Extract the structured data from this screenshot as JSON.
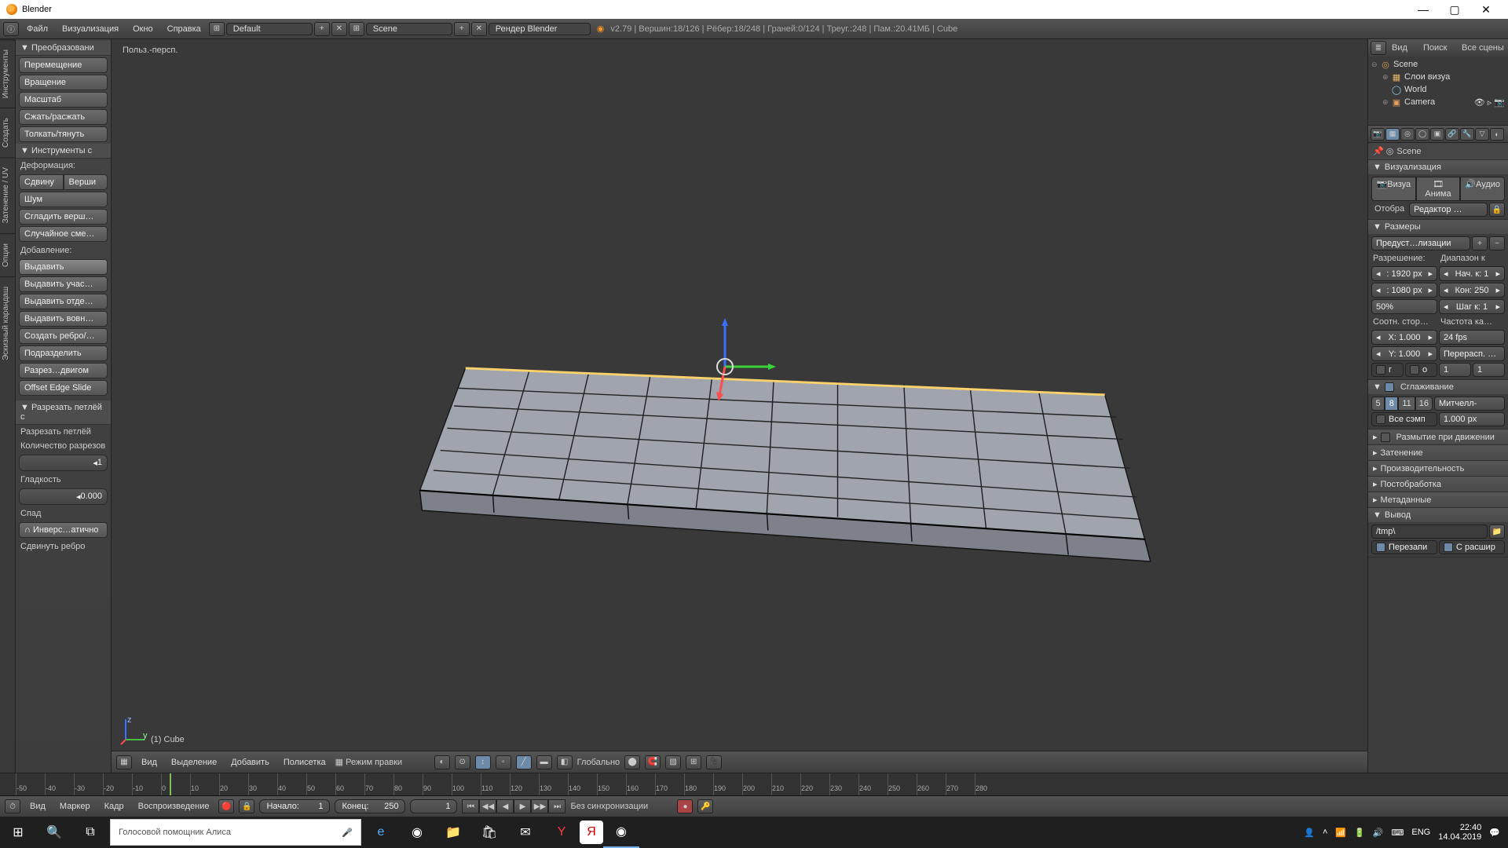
{
  "titlebar": {
    "title": "Blender"
  },
  "topmenu": {
    "file": "Файл",
    "render": "Визуализация",
    "window": "Окно",
    "help": "Справка"
  },
  "header": {
    "layout": "Default",
    "scene": "Scene",
    "engine": "Рендер Blender",
    "stats": "v2.79 | Вершин:18/126 | Рёбер:18/248 | Граней:0/124 | Треуг.:248 | Пам.:20.41МБ | Cube"
  },
  "viewport": {
    "persp": "Польз.-персп.",
    "objlabel": "(1) Cube"
  },
  "toolshelf": {
    "tabs": [
      "Инструменты",
      "Создать",
      "Затенение / UV",
      "Опции",
      "Эскизный карандаш"
    ],
    "transform_hdr": "Преобразовани",
    "transform": [
      "Перемещение",
      "Вращение",
      "Масштаб",
      "Сжать/расжать",
      "Толкать/тянуть"
    ],
    "meshtools_hdr": "Инструменты с",
    "deform_lbl": "Деформация:",
    "deform_row": [
      "Сдвину",
      "Верши"
    ],
    "deform_btns": [
      "Шум",
      "Сгладить верш…",
      "Случайное сме…"
    ],
    "add_lbl": "Добавление:",
    "add_btns": [
      "Выдавить",
      "Выдавить учас…",
      "Выдавить отде…",
      "Выдавить вовн…",
      "Создать ребро/…",
      "Подразделить",
      "Разрез…двигом",
      "Offset Edge Slide"
    ],
    "op_hdr": "Разрезать петлёй с",
    "op_line1": "Разрезать петлёй",
    "cuts_lbl": "Количество разрезов",
    "cuts_val": "1",
    "smooth_lbl": "Гладкость",
    "smooth_val": "0.000",
    "falloff_lbl": "Спад",
    "falloff_val": "Инверс…атично",
    "edgeslide": "Сдвинуть ребро"
  },
  "vpfooter": {
    "view": "Вид",
    "select": "Выделение",
    "add": "Добавить",
    "mesh": "Полисетка",
    "mode": "Режим правки",
    "orient": "Глобально"
  },
  "outliner": {
    "filter": "Поиск",
    "allscenes": "Все сцены",
    "scene": "Scene",
    "renderlayers": "Слои визуа",
    "world": "World",
    "camera": "Camera",
    "view": "Вид"
  },
  "props": {
    "crumb": "Scene",
    "render_hdr": "Визуализация",
    "btns": [
      "Визуа",
      "Анима",
      "Аудио"
    ],
    "display_lbl": "Отобра",
    "display_val": "Редактор …",
    "dim_hdr": "Размеры",
    "preset": "Предуст…лизации",
    "res_lbl": "Разрешение:",
    "range_lbl": "Диапазон к",
    "resx": ": 1920 px",
    "resy": ": 1080 px",
    "respct": "50%",
    "fstart": "Нач. к: 1",
    "fend": "Кон: 250",
    "fstep": "Шаг к: 1",
    "aspect_lbl": "Соотн. стор…",
    "fps_lbl": "Частота ка…",
    "ax": "X:  1.000",
    "ay": "Y:  1.000",
    "fps": "24 fps",
    "remap": "Перерасп. …",
    "border_g": "г",
    "border_o": "о",
    "old": "1",
    "new": "1",
    "aa_hdr": "Сглаживание",
    "aa_samples": [
      "5",
      "8",
      "11",
      "16"
    ],
    "aa_filter": "Митчелл-",
    "fullsample": "Все сэмп",
    "pxwidth": "1.000 px",
    "mblur": "Размытие при движении",
    "shading": "Затенение",
    "perf": "Производительность",
    "post": "Постобработка",
    "meta": "Метаданные",
    "output": "Вывод",
    "outpath": "/tmp\\",
    "overwrite": "Перезапи",
    "extensions": "С расшир"
  },
  "timeline": {
    "view": "Вид",
    "marker": "Маркер",
    "frame": "Кадр",
    "playback": "Воспроизведение",
    "start_lbl": "Начало:",
    "start_val": "1",
    "end_lbl": "Конец:",
    "end_val": "250",
    "current": "1",
    "sync": "Без синхронизации",
    "ticks": [
      "-50",
      "-40",
      "-30",
      "-20",
      "-10",
      "0",
      "10",
      "20",
      "30",
      "40",
      "50",
      "60",
      "70",
      "80",
      "90",
      "100",
      "110",
      "120",
      "130",
      "140",
      "150",
      "160",
      "170",
      "180",
      "190",
      "200",
      "210",
      "220",
      "230",
      "240",
      "250",
      "260",
      "270",
      "280"
    ]
  },
  "taskbar": {
    "search": "Голосовой помощник Алиса",
    "lang": "ENG",
    "time": "22:40",
    "date": "14.04.2019"
  }
}
